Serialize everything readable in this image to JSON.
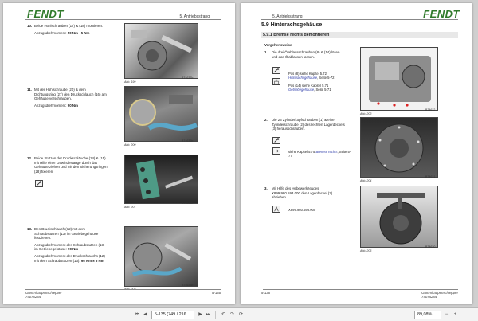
{
  "left_page": {
    "logo": "FENDT",
    "chapter": "5. Antriebsstrang",
    "steps": [
      {
        "num": "10.",
        "text": "Beide Hohlschrauben (17) & (18) montieren.",
        "torque_label": "Anzugsdrehmoment:",
        "torque_value": "50 Nm +5 Nm",
        "fig": "Abb. 199",
        "code": "B74637b"
      },
      {
        "num": "11.",
        "text": "Mit der Hohlschraube (20) & dem Dichtungsring (27) den Druckschlauch (16) am Gehäuse verschrauben.",
        "torque_label": "Anzugsdrehmoment:",
        "torque_value": "90 Nm",
        "fig": "Abb. 200",
        "code": "B74636b"
      },
      {
        "num": "12.",
        "text": "Beide Stutzen der Druckschläuche (14) & (15) mit Hilfe einer Gewindestange durch das Gehäuse ziehen und mit den Sicherungsringen (28) fixieren.",
        "torque_label": "",
        "torque_value": "",
        "fig": "Abb. 201",
        "code": "B74635b"
      },
      {
        "num": "13.",
        "text": "Den Druckschlauch (12) mit dem Schraubstutzen (13) im Getriebegehäuse festziehen.",
        "torque_label": "Anzugsdrehmoment des Schraubstutzen (13) im Getriebegehäuse:",
        "torque_value": "90 Nm",
        "torque_label2": "Anzugsdrehmoment des Druckschlauchs (12) mit dem Schraubstutzen (13):",
        "torque_value2": "95 Nm ± 5 Nm",
        "fig": "Abb. 202",
        "code": "B74633b"
      }
    ],
    "footer_line1": "Gummiraupenschlepper",
    "footer_line2": "79075254",
    "page_number": "5-135"
  },
  "right_page": {
    "logo": "FENDT",
    "chapter": "5. Antriebsstrang",
    "section_title": "5.9    Hinterachsgehäuse",
    "subsection_title": "5.9.1  Bremse rechts demontieren",
    "procedure_label": "Vorgehensweise",
    "steps": [
      {
        "num": "1.",
        "text": "Die drei Ölablassschrauben (8) & (14) lösen und das Ölablassen lassen.",
        "refs": [
          {
            "prefix": "Pos (8) siehe Kapitel 5.72",
            "link": "Hinterachsgehäuse",
            "suffix": ", Seite 5-72"
          },
          {
            "prefix": "Pos (14) siehe Kapitel 5.71",
            "link": "Getriebegehäuse",
            "suffix": ", Seite 5-71"
          }
        ],
        "fig": "Abb. 203",
        "code": "B74632"
      },
      {
        "num": "2.",
        "text": "Die 23 Zylinderkopfschrauben (1) & eine Zylinderschraube (2) des rechten Lagerdeckels (3) herausschrauben.",
        "refs": [
          {
            "prefix": "siehe Kapitel 5.75",
            "link": "Bremse rechts",
            "suffix": ", Seite 5-77"
          }
        ],
        "fig": "Abb. 204",
        "code": "B74631"
      },
      {
        "num": "3.",
        "text": "Mit Hilfe des Hebewerkzeuges X899.980.593.000 den Lagerdeckel (3) abziehen.",
        "tool": "X899.980.593.000",
        "refs": [],
        "fig": "Abb. 205",
        "code": "B74630"
      }
    ],
    "footer_line1": "Gummiraupenschlepper",
    "footer_line2": "79075254",
    "page_number": "5-136"
  },
  "toolbar": {
    "page_field": "5-135 (749 / 216",
    "zoom_field": "89,08%",
    "icons": [
      "first-page-icon",
      "prev-page-icon",
      "next-page-icon",
      "last-page-icon",
      "back-icon",
      "forward-icon",
      "rotate-icon",
      "zoom-out-icon",
      "zoom-in-icon"
    ]
  }
}
